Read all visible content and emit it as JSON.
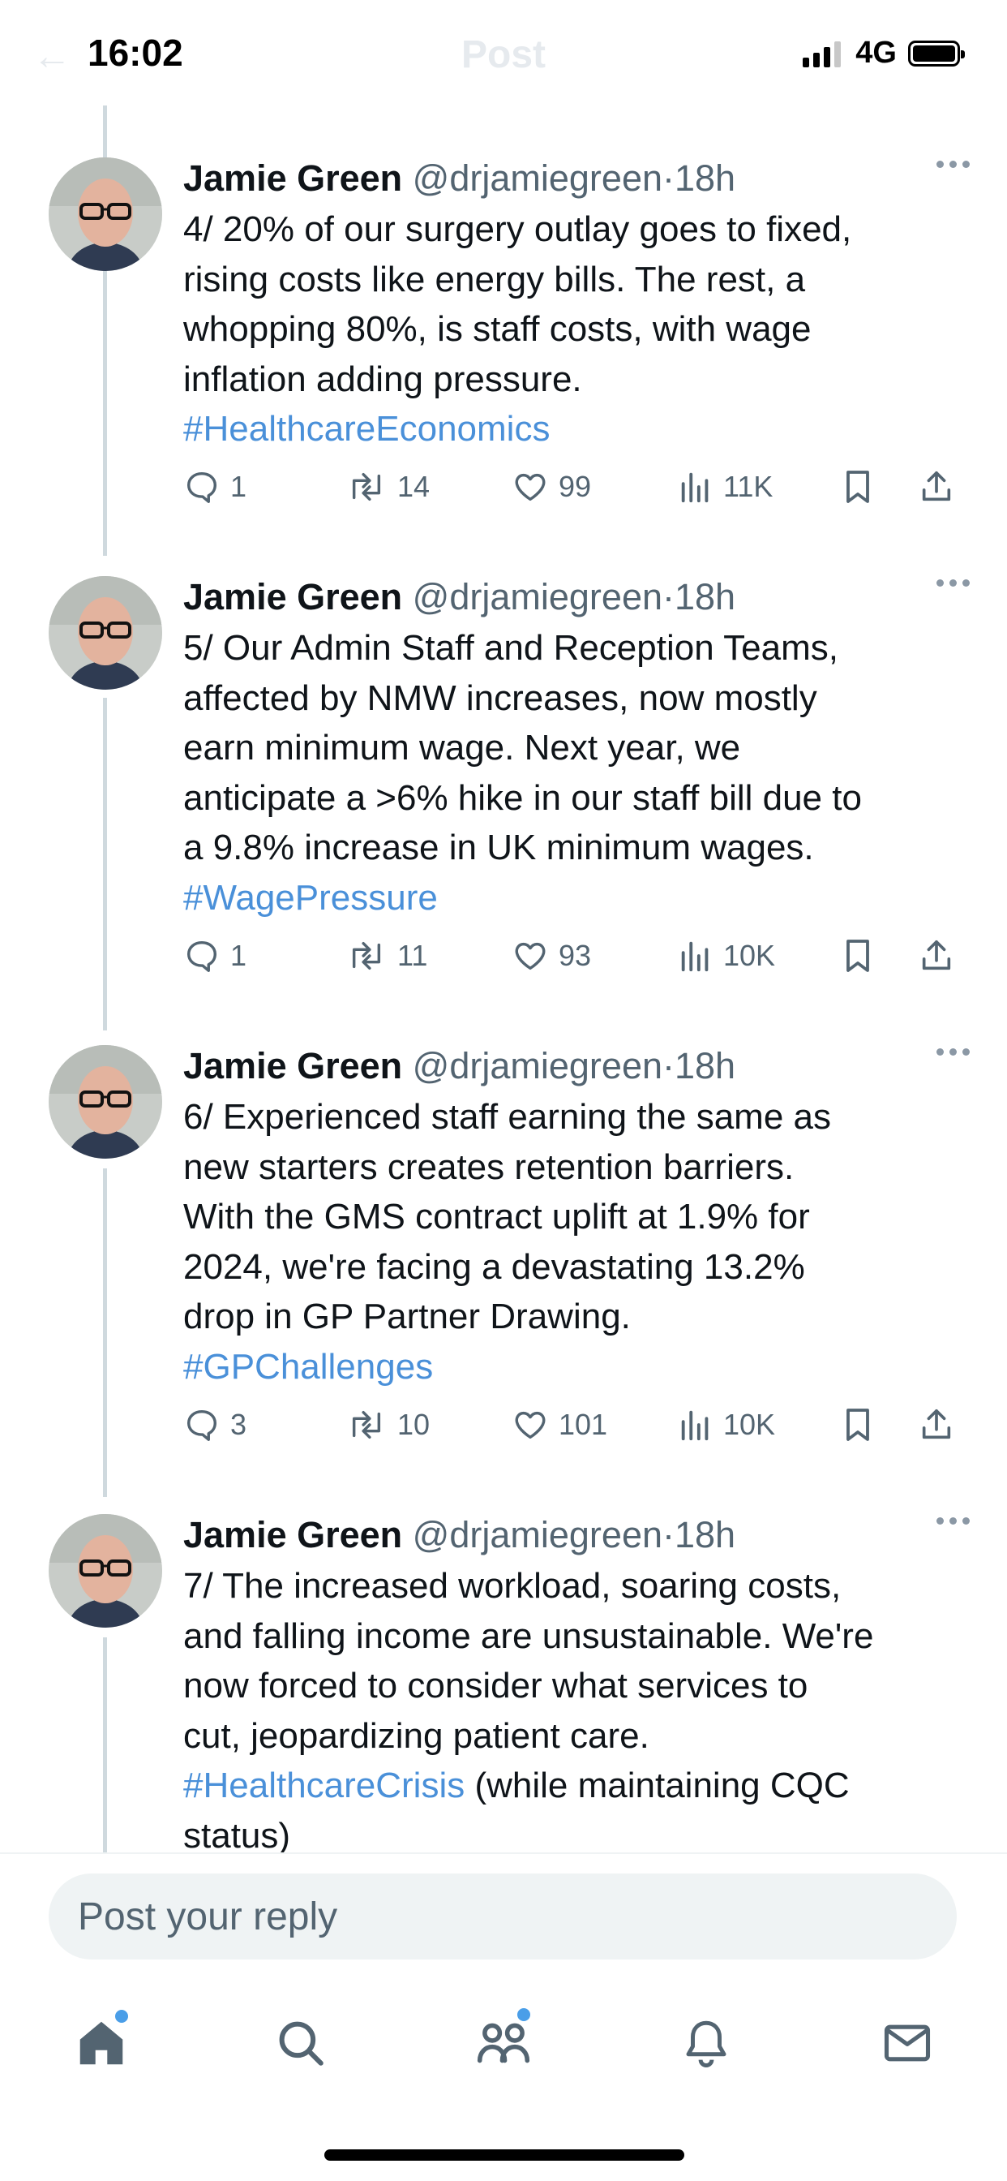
{
  "status_bar": {
    "time": "16:02",
    "network": "4G"
  },
  "header": {
    "title": "Post"
  },
  "tweets": [
    {
      "name": "Jamie Green",
      "handle": "@drjamiegreen",
      "sep": "·",
      "time": "18h",
      "lines": [
        "4/ 20% of our surgery outlay goes to fixed,",
        "rising costs like energy bills. The rest, a",
        "whopping 80%, is staff costs, with wage",
        "inflation adding pressure."
      ],
      "hashtag": "#HealthcareEconomics",
      "hashtag_suffix": "",
      "replies": "1",
      "reposts": "14",
      "likes": "99",
      "views": "11K"
    },
    {
      "name": "Jamie Green",
      "handle": "@drjamiegreen",
      "sep": "·",
      "time": "18h",
      "lines": [
        "5/ Our Admin Staff and Reception Teams,",
        "affected by NMW increases, now mostly",
        "earn minimum wage. Next year, we",
        "anticipate a >6% hike in our staff bill due to",
        "a 9.8% increase in UK minimum wages."
      ],
      "hashtag": "#WagePressure",
      "hashtag_suffix": "",
      "replies": "1",
      "reposts": "11",
      "likes": "93",
      "views": "10K"
    },
    {
      "name": "Jamie Green",
      "handle": "@drjamiegreen",
      "sep": "·",
      "time": "18h",
      "lines": [
        "6/ Experienced staff earning the same as",
        "new starters creates retention barriers.",
        "With the GMS contract uplift at 1.9% for",
        "2024, we're facing a devastating 13.2%",
        "drop in GP Partner Drawing."
      ],
      "hashtag": "#GPChallenges",
      "hashtag_suffix": "",
      "replies": "3",
      "reposts": "10",
      "likes": "101",
      "views": "10K"
    },
    {
      "name": "Jamie Green",
      "handle": "@drjamiegreen",
      "sep": "·",
      "time": "18h",
      "lines": [
        "7/ The increased workload, soaring costs,",
        "and falling income are unsustainable. We're",
        "now forced to consider what services to",
        "cut, jeopardizing patient care."
      ],
      "hashtag": "#HealthcareCrisis",
      "hashtag_suffix": " (while maintaining CQC",
      "tail_line": "status)"
    }
  ],
  "composer": {
    "placeholder": "Post your reply"
  },
  "icons": {
    "reply": "speech-bubble-icon",
    "repost": "repost-arrows-icon",
    "like": "heart-icon",
    "views": "bar-chart-icon",
    "bookmark": "bookmark-icon",
    "share": "share-icon",
    "tabs": [
      "home-icon",
      "search-icon",
      "communities-icon",
      "bell-icon",
      "mail-icon"
    ]
  },
  "colors": {
    "link": "#4a90d9",
    "muted": "#536471",
    "thread_line": "#cfd9de",
    "badge": "#4a9ee8"
  }
}
